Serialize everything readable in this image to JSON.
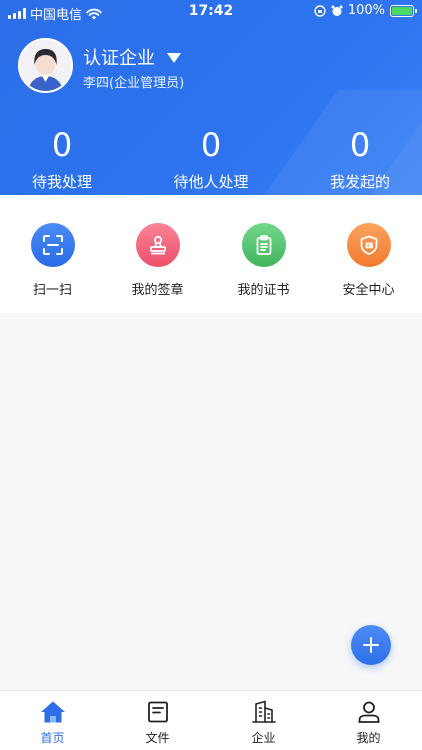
{
  "status_bar": {
    "carrier": "中国电信",
    "time": "17:42",
    "battery": "100%"
  },
  "profile": {
    "company_name": "认证企业",
    "user_role": "李四(企业管理员)"
  },
  "stats": [
    {
      "value": "0",
      "label": "待我处理"
    },
    {
      "value": "0",
      "label": "待他人处理"
    },
    {
      "value": "0",
      "label": "我发起的"
    }
  ],
  "quick_actions": [
    {
      "label": "扫一扫",
      "icon": "scan-icon",
      "color": "#2f74ee"
    },
    {
      "label": "我的签章",
      "icon": "stamp-icon",
      "color": "#f2637b"
    },
    {
      "label": "我的证书",
      "icon": "certificate-icon",
      "color": "#54c66f"
    },
    {
      "label": "安全中心",
      "icon": "shield-icon",
      "color": "#f6883b"
    }
  ],
  "tabs": [
    {
      "label": "首页",
      "icon": "home-icon",
      "active": true
    },
    {
      "label": "文件",
      "icon": "file-icon",
      "active": false
    },
    {
      "label": "企业",
      "icon": "building-icon",
      "active": false
    },
    {
      "label": "我的",
      "icon": "person-icon",
      "active": false
    }
  ],
  "colors": {
    "primary": "#2d6fe8",
    "background": "#f7f7f8"
  }
}
